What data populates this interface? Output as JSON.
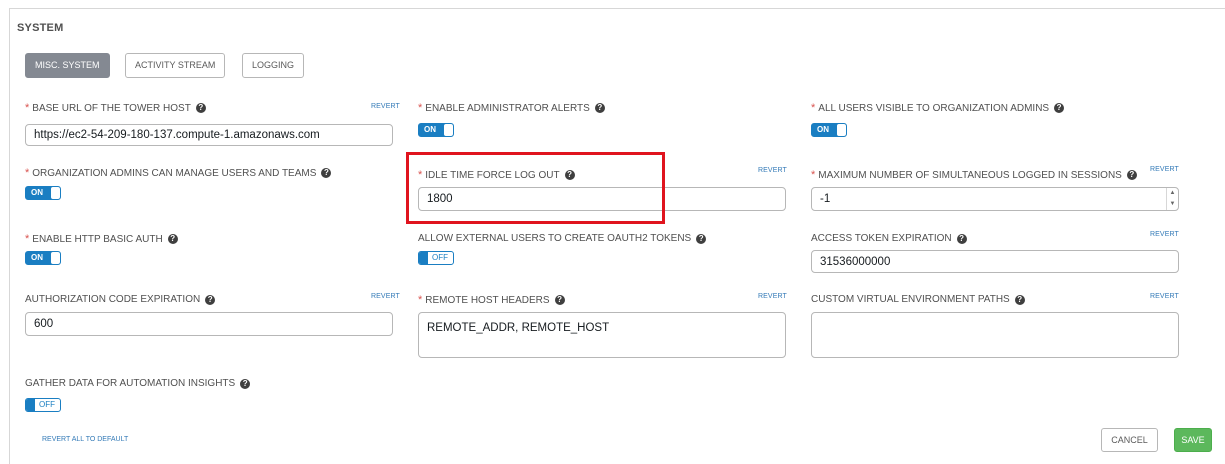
{
  "section": {
    "title": "SYSTEM"
  },
  "tabs": [
    {
      "label": "MISC. SYSTEM",
      "active": true
    },
    {
      "label": "ACTIVITY STREAM",
      "active": false
    },
    {
      "label": "LOGGING",
      "active": false
    }
  ],
  "common": {
    "revert": "REVERT",
    "help_glyph": "?",
    "required_mark": "*"
  },
  "fields": {
    "base_url": {
      "label": "BASE URL OF THE TOWER HOST",
      "value": "https://ec2-54-209-180-137.compute-1.amazonaws.com"
    },
    "admin_alerts": {
      "label": "ENABLE ADMINISTRATOR ALERTS",
      "state": "ON"
    },
    "users_visible": {
      "label": "ALL USERS VISIBLE TO ORGANIZATION ADMINS",
      "state": "ON"
    },
    "org_admins_manage": {
      "label": "ORGANIZATION ADMINS CAN MANAGE USERS AND TEAMS",
      "state": "ON"
    },
    "idle_timeout": {
      "label": "IDLE TIME FORCE LOG OUT",
      "value": "1800"
    },
    "max_sessions": {
      "label": "MAXIMUM NUMBER OF SIMULTANEOUS LOGGED IN SESSIONS",
      "value": "-1"
    },
    "http_basic_auth": {
      "label": "ENABLE HTTP BASIC AUTH",
      "state": "ON"
    },
    "external_oauth": {
      "label": "ALLOW EXTERNAL USERS TO CREATE OAUTH2 TOKENS",
      "state": "OFF"
    },
    "access_token_exp": {
      "label": "ACCESS TOKEN EXPIRATION",
      "value": "31536000000"
    },
    "auth_code_exp": {
      "label": "AUTHORIZATION CODE EXPIRATION",
      "value": "600"
    },
    "remote_headers": {
      "label": "REMOTE HOST HEADERS",
      "value": "REMOTE_ADDR, REMOTE_HOST"
    },
    "custom_venv": {
      "label": "CUSTOM VIRTUAL ENVIRONMENT PATHS",
      "value": ""
    },
    "insights": {
      "label": "GATHER DATA FOR AUTOMATION INSIGHTS",
      "state": "OFF"
    }
  },
  "footer": {
    "revert_all": "REVERT ALL TO DEFAULT",
    "cancel": "CANCEL",
    "save": "SAVE"
  },
  "colors": {
    "accent": "#1a7ec2",
    "required": "#d9534f",
    "save": "#5cb85c",
    "highlight": "#e0141e"
  }
}
